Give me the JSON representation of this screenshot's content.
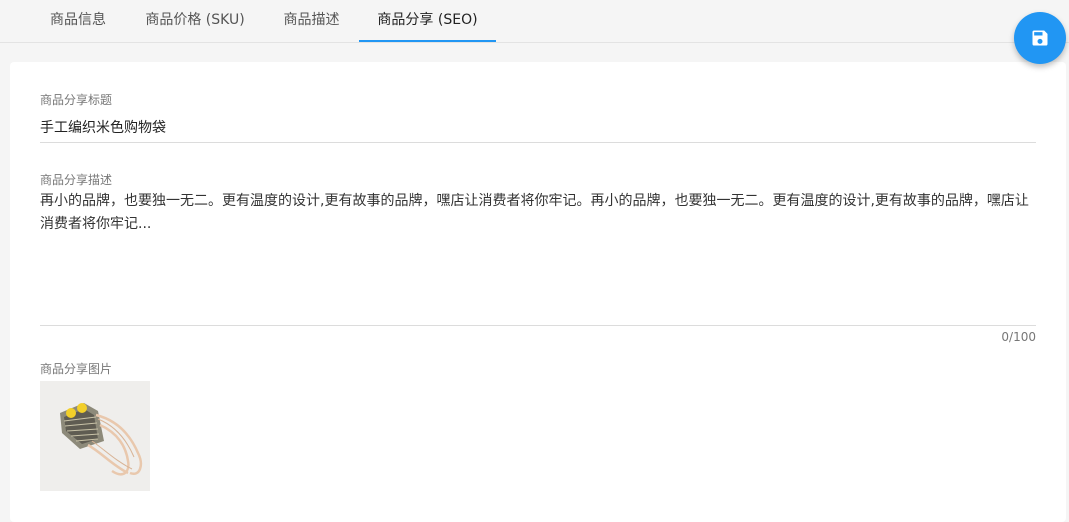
{
  "tabs": [
    {
      "label": "商品信息"
    },
    {
      "label": "商品价格 (SKU)"
    },
    {
      "label": "商品描述"
    },
    {
      "label": "商品分享 (SEO)"
    }
  ],
  "active_tab": "商品分享 (SEO)",
  "form": {
    "share_title": {
      "label": "商品分享标题",
      "value": "手工编织米色购物袋"
    },
    "share_description": {
      "label": "商品分享描述",
      "value": "再小的品牌，也要独一无二。更有温度的设计,更有故事的品牌，嘿店让消费者将你牢记。再小的品牌，也要独一无二。更有温度的设计,更有故事的品牌，嘿店让消费者将你牢记...",
      "counter": "0/100"
    },
    "share_image": {
      "label": "商品分享图片",
      "image_name": "woven-bag-thumbnail"
    }
  },
  "fab": {
    "icon": "save-icon"
  },
  "colors": {
    "accent": "#2196f3",
    "background": "#f5f5f5",
    "card": "#ffffff"
  }
}
